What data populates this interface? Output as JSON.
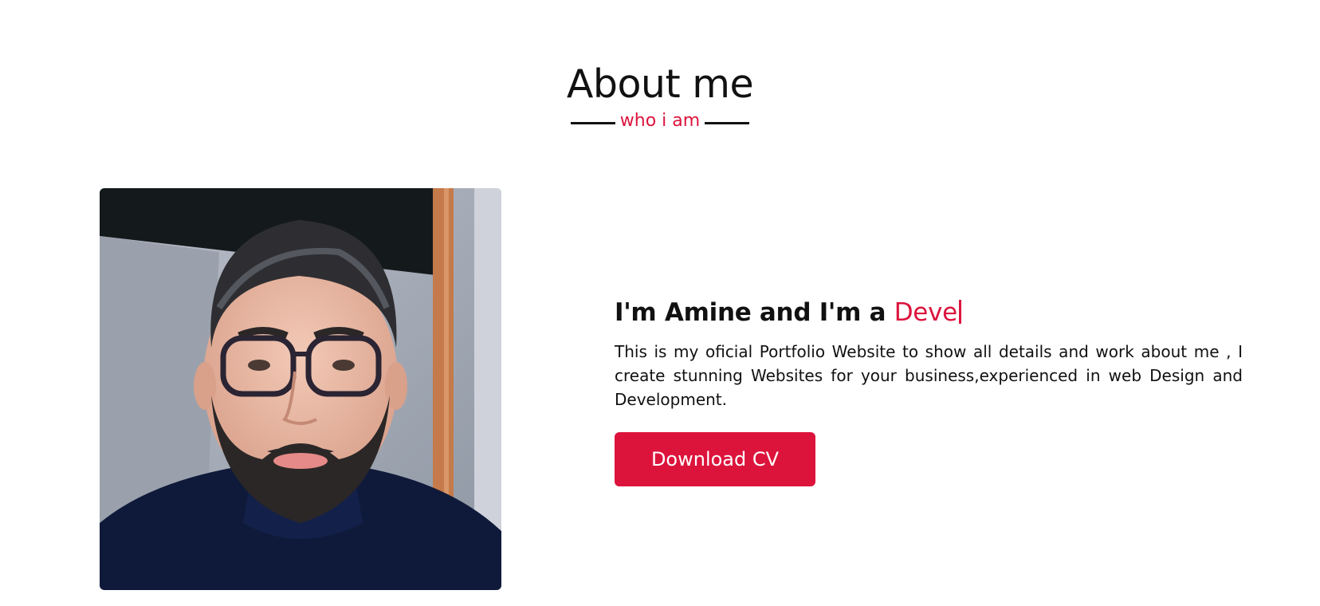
{
  "about": {
    "title": "About me",
    "subtitle": "who i am",
    "heading_prefix": "I'm Amine and I'm a ",
    "heading_typed": "Deve",
    "paragraph": "This is my oficial Portfolio Website to show all details and work about me , I create stunning Websites for your business,experienced in web Design and Development.",
    "download_label": "Download CV"
  },
  "colors": {
    "accent": "#dc143c",
    "text": "#111111",
    "background": "#ffffff"
  }
}
